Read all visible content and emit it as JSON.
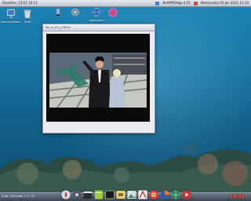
{
  "menubar": {
    "left_text": "Deadline: 12/11 10:13",
    "right_items": [
      "NetWMOdge 4.55",
      "Wednesday 05 Jan 2011 15:30"
    ]
  },
  "desktop_icons": [
    {
      "label": "MachineName",
      "icon": "monitor-icon"
    },
    {
      "label": "Trash",
      "icon": "trash-icon"
    },
    {
      "label": "",
      "icon": "phone-icon"
    },
    {
      "label": "",
      "icon": "gear-icon"
    },
    {
      "label": "Application",
      "icon": "globe-icon"
    },
    {
      "label": "",
      "icon": "cube-icon"
    }
  ],
  "player_window": {
    "title": "Tor_ls_2F_s_HD.flv"
  },
  "taskbar": {
    "left_label": "Snail / Recorder  1.0 / 10",
    "clock": "16:32"
  },
  "dock_items": [
    "compass-icon",
    "settings-icon",
    "clapperboard-icon",
    "notes-icon",
    "terminal-icon",
    "archive-icon",
    "image-viewer-icon",
    "acrobat-icon",
    "color-picker-icon",
    "firefox-icon",
    "globe-icon",
    "media-player-icon"
  ],
  "colors": {
    "desktop_top": "#1c84b4",
    "desktop_bottom": "#0f4f70",
    "clock": "#ff5540"
  }
}
